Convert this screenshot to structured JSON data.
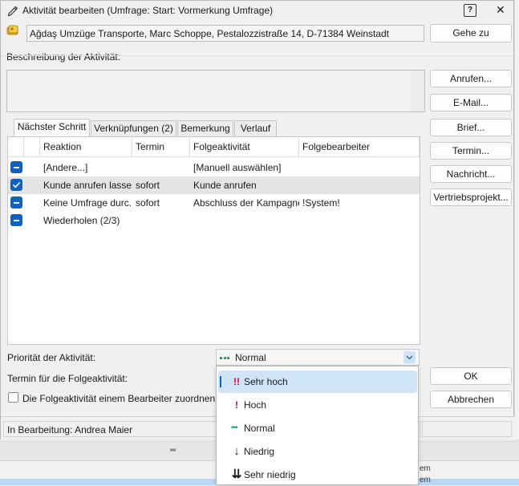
{
  "window": {
    "title": "Aktivität bearbeiten (Umfrage: Start: Vormerkung Umfrage)",
    "help_glyph": "?",
    "close_glyph": "✕"
  },
  "contact": {
    "address": "Ağdaş Umzüge  Transporte, Marc Schoppe, Pestalozzistraße 14, D-71384 Weinstadt",
    "goto_label": "Gehe zu"
  },
  "description": {
    "label": "Beschreibung der Aktivität:",
    "value": ""
  },
  "side_buttons": [
    "Anrufen...",
    "E-Mail...",
    "Brief...",
    "Termin...",
    "Nachricht...",
    "Vertriebsprojekt..."
  ],
  "tabs": [
    "Nächster Schritt",
    "Verknüpfungen (2)",
    "Bemerkung",
    "Verlauf"
  ],
  "grid": {
    "columns": [
      "Reaktion",
      "Termin",
      "Folgeaktivität",
      "Folgebearbeiter"
    ],
    "rows": [
      {
        "state": "indeterminate",
        "cells": [
          "[Andere...]",
          "",
          "[Manuell auswählen]",
          ""
        ]
      },
      {
        "state": "checked",
        "cells": [
          "Kunde anrufen lassen",
          "sofort",
          "Kunde anrufen",
          ""
        ]
      },
      {
        "state": "indeterminate",
        "cells": [
          "Keine Umfrage durc...",
          "sofort",
          "Abschluss der Kampagne",
          "!System!"
        ]
      },
      {
        "state": "indeterminate",
        "cells": [
          "Wiederholen (2/3)",
          "",
          "",
          ""
        ]
      }
    ]
  },
  "priority": {
    "label": "Priorität der Aktivität:",
    "selected": "Normal",
    "options": [
      {
        "icon": "!!",
        "label": "Sehr hoch",
        "color": "#d9001b"
      },
      {
        "icon": "!",
        "label": "Hoch",
        "color": "#d9001b"
      },
      {
        "icon": "•••",
        "label": "Normal",
        "color": "#17a66b"
      },
      {
        "icon": "↓",
        "label": "Niedrig",
        "color": "#000000"
      },
      {
        "icon": "⇊",
        "label": "Sehr niedrig",
        "color": "#000000"
      }
    ]
  },
  "followup": {
    "date_label": "Termin für die Folgeaktivität:",
    "assign_label": "Die Folgeaktivität einem Bearbeiter zuordnen:"
  },
  "actions": {
    "ok": "OK",
    "cancel": "Abbrechen"
  },
  "status": {
    "text": "In Bearbeitung: Andrea Maier"
  },
  "background": {
    "row_suffix_1": "em",
    "row_suffix_2": "em"
  },
  "colors": {
    "accent": "#0a64c8",
    "highlight": "#cfe5f7",
    "normal_priority": "#17a66b",
    "high_priority": "#d9001b"
  }
}
